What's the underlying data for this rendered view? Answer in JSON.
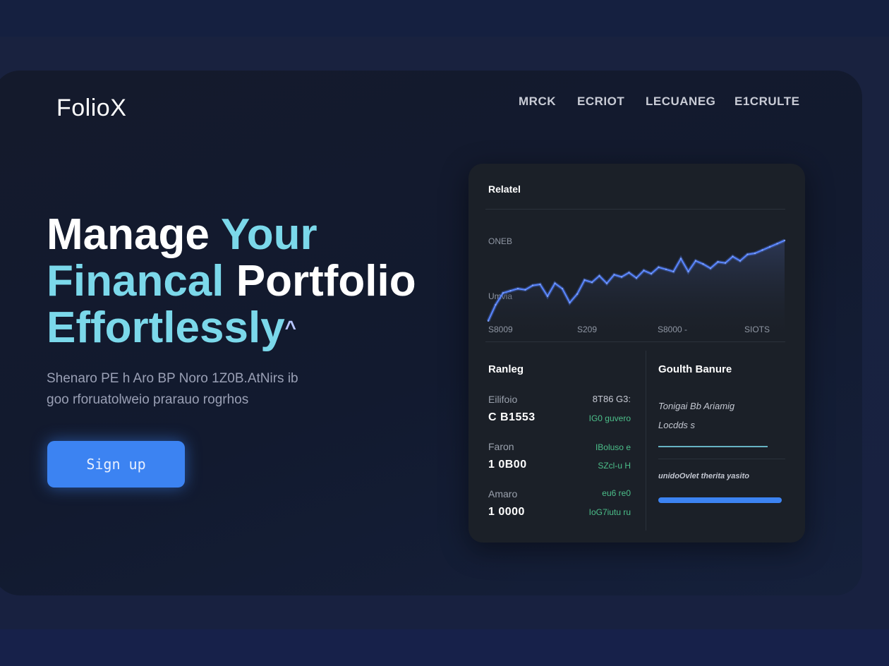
{
  "brand": {
    "name": "FolioX"
  },
  "nav": {
    "items": [
      "MRCK",
      "ECRIOT",
      "LECUANEG",
      "E1CRULTE"
    ]
  },
  "hero": {
    "headline_line1_a": "Manage",
    "headline_line1_b": "Your",
    "headline_line2_a": "Financal",
    "headline_line2_b": "Portfolio",
    "headline_line3": "Effortlessly",
    "headline_mark": "^",
    "subtext_line1": "Shenaro PE h Aro BP Noro 1Z0B.AtNirs ib",
    "subtext_line2": "goo rforuatolweio prarauo rogrhos",
    "signup_label": "Sign up"
  },
  "dashboard": {
    "title": "Relatel",
    "chart_ylabel_top": "ONEB",
    "chart_ylabel_bottom": "Umvia",
    "chart_xlabels": [
      "S8009",
      "S209",
      "S8000 -",
      "SIOTS"
    ],
    "left_panel": {
      "title": "Ranleg",
      "rows": [
        {
          "label": "Eilifoio",
          "value": "C B1553",
          "right_top": "8T86 G3:",
          "right_green": "IG0 guvero"
        },
        {
          "label": "Faron",
          "value": "1 0B00",
          "right_top": "",
          "right_green": "IBoluso e"
        },
        {
          "label": "Amaro",
          "value": "1 0000",
          "right_top": "",
          "right_green": "eu6 re0"
        }
      ],
      "extra_green": [
        "SZcl-u H",
        "IoG7iutu ru"
      ]
    },
    "right_panel": {
      "title": "Goulth Banure",
      "line1": "Tonigai Bb Ariamig",
      "line2": "Locdds s",
      "caption": "unidoOvlet therita yasito",
      "progress": 1.0
    }
  },
  "chart_data": {
    "type": "line",
    "x": [
      0,
      1,
      2,
      3,
      4,
      5,
      6,
      7,
      8,
      9,
      10,
      11,
      12,
      13,
      14,
      15,
      16,
      17,
      18,
      19,
      20,
      21,
      22,
      23,
      24,
      25,
      26,
      27,
      28,
      29,
      30,
      31,
      32,
      33,
      34,
      35,
      36,
      37,
      38,
      39,
      40
    ],
    "series": [
      {
        "values": [
          10,
          25,
          36,
          38,
          40,
          39,
          43,
          44,
          33,
          45,
          40,
          27,
          35,
          48,
          46,
          52,
          45,
          53,
          51,
          55,
          50,
          57,
          54,
          60,
          58,
          56,
          68,
          56,
          66,
          63,
          59,
          65,
          64,
          70,
          66,
          72,
          73,
          76,
          79,
          82,
          85
        ]
      }
    ],
    "ylim": [
      0,
      100
    ],
    "grid": false,
    "colors": {
      "line": "#4f7df5",
      "fill_top": "#3a4a78"
    }
  },
  "colors": {
    "accent": "#7bd8ea",
    "primary": "#3c83f2",
    "positive": "#4cbf8a"
  }
}
